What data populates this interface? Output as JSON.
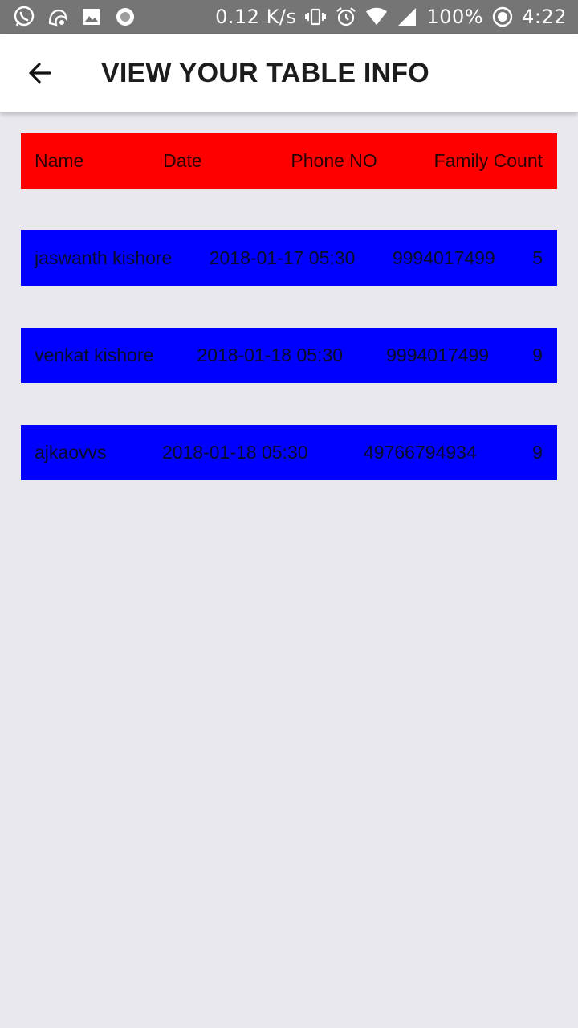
{
  "status_bar": {
    "left_icons": [
      "whatsapp-icon",
      "uc-browser-icon",
      "image-icon",
      "record-icon"
    ],
    "speed": "0.12 K/s",
    "battery": "100%",
    "time": "4:22"
  },
  "app_bar": {
    "title": "VIEW YOUR TABLE INFO"
  },
  "table": {
    "header": {
      "name": "Name",
      "date": "Date",
      "phone": "Phone NO",
      "family": "Family Count"
    },
    "rows": [
      {
        "name": "jaswanth kishore",
        "date": "2018-01-17 05:30",
        "phone": "9994017499",
        "family": "5"
      },
      {
        "name": "venkat kishore",
        "date": "2018-01-18 05:30",
        "phone": "9994017499",
        "family": "9"
      },
      {
        "name": "ajkaovvs",
        "date": "2018-01-18 05:30",
        "phone": "49766794934",
        "family": "9"
      }
    ],
    "colors": {
      "header_bg": "#ff0000",
      "row_bg": "#0000ff",
      "page_bg": "#e9e8ee"
    }
  }
}
